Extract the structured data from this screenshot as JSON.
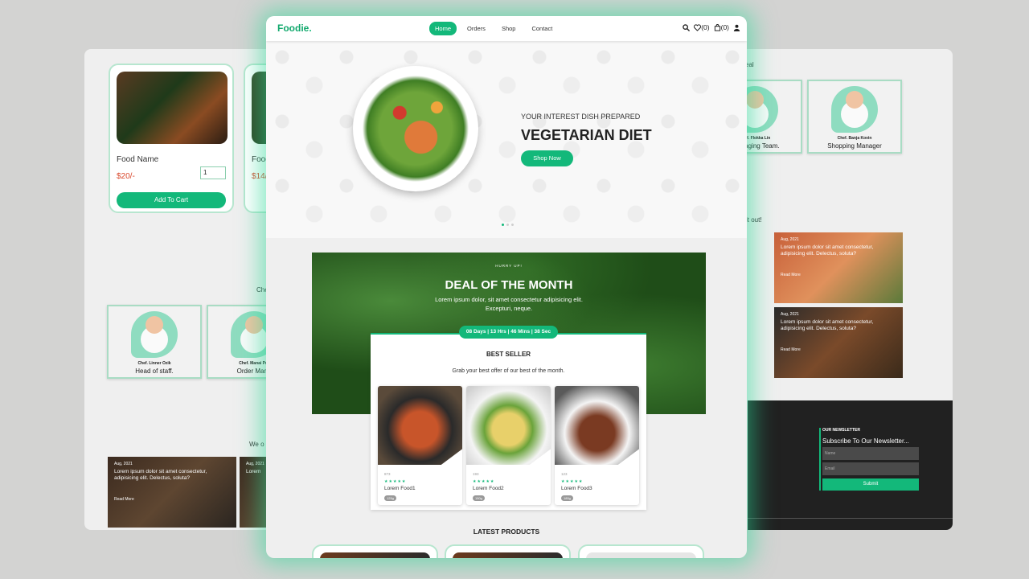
{
  "background_page": {
    "product_cards": [
      {
        "name": "Food Name",
        "price": "$20/-",
        "qty": "1",
        "cart_label": "Add To Cart"
      },
      {
        "name": "Food",
        "price": "$14/-"
      }
    ],
    "chefs_heading": "Che",
    "chefs": [
      {
        "name": "Chef. Linner Ozik",
        "role": "Head of staff."
      },
      {
        "name": "Chef. Manai Pra",
        "role": "Order Mana"
      },
      {
        "name": "Chef. Flokka Lin",
        "role": "Packaging Team."
      },
      {
        "name": "Chef. Banja Kovin",
        "role": "Shopping Manager"
      }
    ],
    "top_right_text": "eal",
    "blog_heading_left": "We o",
    "blog_heading_right": "it out!",
    "blogs": [
      {
        "date": "Aug, 2021",
        "text": "Lorem ipsum dolor sit amet consectetur, adipisicing elit. Delectus, soluta?",
        "read_more": "Read More"
      },
      {
        "date": "Aug, 2021",
        "text": "Lorem"
      },
      {
        "date": "Aug, 2021",
        "text": "Lorem ipsum dolor sit amet consectetur, adipisicing elit. Delectus, soluta?",
        "read_more": "Read More"
      },
      {
        "date": "Aug, 2021",
        "text": "Lorem ipsum dolor sit amet consectetur, adipisicing elit. Delectus, soluta?",
        "read_more": "Read More"
      }
    ],
    "newsletter": {
      "heading": "OUR NEWSLETTER",
      "subtitle": "Subscribe To Our Newsletter...",
      "name_placeholder": "Name",
      "email_placeholder": "Email",
      "submit_label": "Submit"
    }
  },
  "main": {
    "logo": "Foodie",
    "logo_dot": ".",
    "nav": [
      "Home",
      "Orders",
      "Shop",
      "Contact"
    ],
    "active_nav": "Home",
    "wishlist_count": "(0)",
    "cart_count": "(0)",
    "hero": {
      "subtitle": "YOUR INTEREST DISH PREPARED",
      "title": "VEGETARIAN DIET",
      "button": "Shop Now"
    },
    "deal": {
      "hurry": "HURRY UP!",
      "title": "DEAL OF THE MONTH",
      "text": "Lorem ipsum dolor, sit amet consectetur adipisicing elit. Excepturi, neque.",
      "timer": "08 Days | 13 Hrs | 46 Mins | 38 Sec"
    },
    "best_seller": {
      "title": "BEST SELLER",
      "subtitle": "Grab your best offer of our best of the month.",
      "products": [
        {
          "count": "873",
          "name": "Lorem Food1",
          "tag": "125g",
          "rating": 5
        },
        {
          "count": "193",
          "name": "Lorem Food2",
          "tag": "150g",
          "rating": 5
        },
        {
          "count": "123",
          "name": "Lorem Food3",
          "tag": "180g",
          "rating": 5
        }
      ]
    },
    "latest_title": "LATEST PRODUCTS"
  },
  "colors": {
    "accent": "#13b87a",
    "price": "#d9472b",
    "footer_dark": "#212121"
  }
}
